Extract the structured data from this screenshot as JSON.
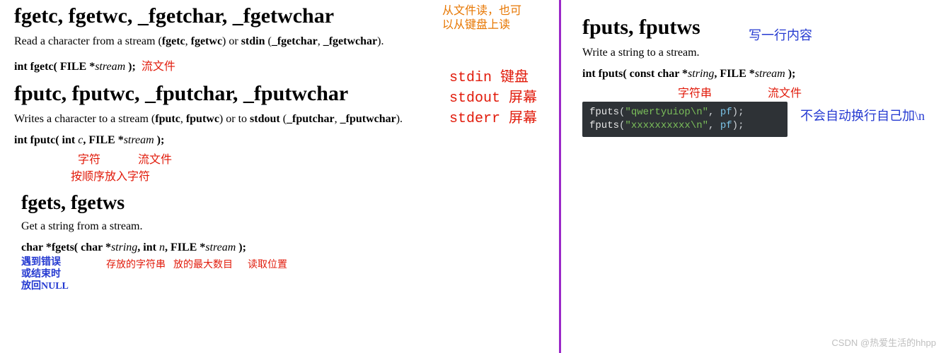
{
  "left": {
    "sec1": {
      "title": "fgetc, fgetwc, _fgetchar, _fgetwchar",
      "desc_pre": "Read a character from a stream (",
      "desc_b1": "fgetc",
      "desc_sep1": ", ",
      "desc_b2": "fgetwc",
      "desc_mid": ") or ",
      "desc_b3": "stdin",
      "desc_mid2": " (",
      "desc_b4": "_fgetchar",
      "desc_sep2": ", ",
      "desc_b5": "_fgetwchar",
      "desc_end": ").",
      "proto_a": "int fgetc( FILE *",
      "proto_b": "stream",
      "proto_c": " );",
      "ann_stream": "流文件",
      "top_note_l1": "从文件读，也可",
      "top_note_l2": "以从键盘上读",
      "std_l1": "stdin  键盘",
      "std_l2": "stdout 屏幕",
      "std_l3": "stderr 屏幕"
    },
    "sec2": {
      "title": "fputc, fputwc, _fputchar, _fputwchar",
      "desc_pre": "Writes a character to a stream (",
      "desc_b1": "fputc",
      "desc_sep1": ", ",
      "desc_b2": "fputwc",
      "desc_mid": ") or to ",
      "desc_b3": "stdout",
      "desc_mid2": " (",
      "desc_b4": "_fputchar",
      "desc_sep2": ", ",
      "desc_b5": "_fputwchar",
      "desc_end": ").",
      "proto_a": "int fputc( int ",
      "proto_b": "c",
      "proto_c": ", FILE *",
      "proto_d": "stream",
      "proto_e": " );",
      "ann_char": "字符",
      "ann_stream": "流文件",
      "ann_order": "按顺序放入字符"
    },
    "sec3": {
      "title": "fgets, fgetws",
      "desc": "Get a string from a stream.",
      "proto_a": "char *fgets( char *",
      "proto_b": "string",
      "proto_c": ", int ",
      "proto_d": "n",
      "proto_e": ", FILE *",
      "proto_f": "stream",
      "proto_g": " );",
      "ann_store": "存放的字符串",
      "ann_max": "放的最大数目",
      "ann_pos": "读取位置",
      "err_l1": "遇到错误",
      "err_l2": "或结束时",
      "err_l3": "放回NULL"
    }
  },
  "right": {
    "title": "fputs, fputws",
    "top_note": "写一行内容",
    "desc": "Write a string to a stream.",
    "proto_a": "int fputs( const char *",
    "proto_b": "string",
    "proto_c": ", FILE *",
    "proto_d": "stream",
    "proto_e": " );",
    "ann_str": "字符串",
    "ann_stream": "流文件",
    "code_l1_fn": "fputs",
    "code_l1_open": "(",
    "code_l1_str": "\"qwertyuiop\\n\"",
    "code_l1_mid": ", ",
    "code_l1_id": "pf",
    "code_l1_end": ");",
    "code_l2_fn": "fputs",
    "code_l2_open": "(",
    "code_l2_str": "\"xxxxxxxxxx\\n\"",
    "code_l2_mid": ", ",
    "code_l2_id": "pf",
    "code_l2_end": ");",
    "note_nolf": "不会自动换行自己加\\n"
  },
  "watermark": "CSDN @热爱生活的hhpp"
}
